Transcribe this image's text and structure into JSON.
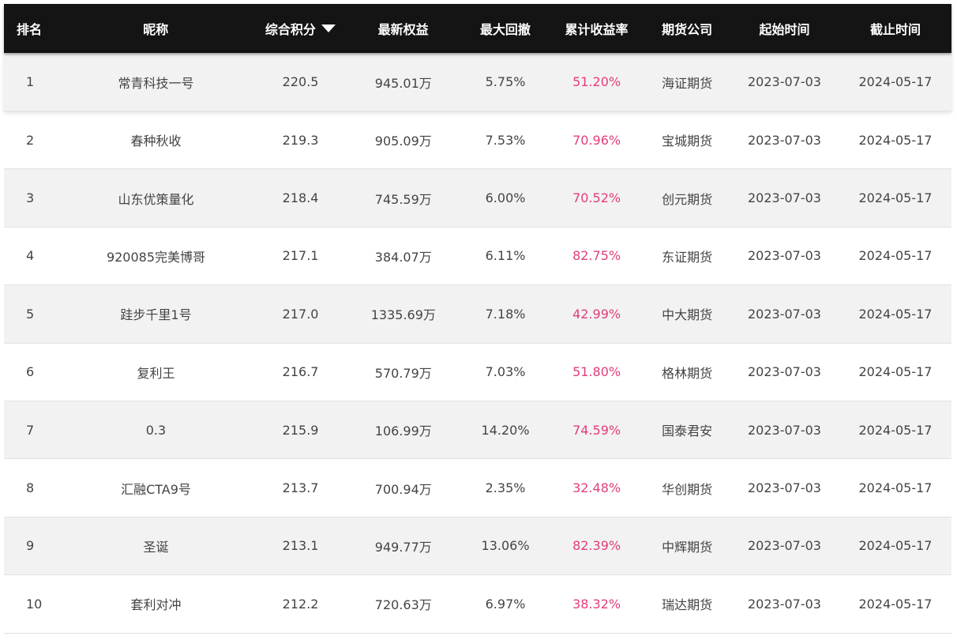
{
  "header": {
    "rank": "排名",
    "name": "昵称",
    "score": "综合积分",
    "equity": "最新权益",
    "drawdown": "最大回撤",
    "return": "累计收益率",
    "company": "期货公司",
    "start": "起始时间",
    "end": "截止时间"
  },
  "sort_icon": "triangle-down-icon",
  "colors": {
    "header_bg": "#141414",
    "return_color": "#e23d7c",
    "stripe": "#f2f2f2"
  },
  "rows": [
    {
      "rank": "1",
      "name": "常青科技一号",
      "score": "220.5",
      "equity": "945.01万",
      "drawdown": "5.75%",
      "return": "51.20%",
      "company": "海证期货",
      "start": "2023-07-03",
      "end": "2024-05-17"
    },
    {
      "rank": "2",
      "name": "春种秋收",
      "score": "219.3",
      "equity": "905.09万",
      "drawdown": "7.53%",
      "return": "70.96%",
      "company": "宝城期货",
      "start": "2023-07-03",
      "end": "2024-05-17"
    },
    {
      "rank": "3",
      "name": "山东优策量化",
      "score": "218.4",
      "equity": "745.59万",
      "drawdown": "6.00%",
      "return": "70.52%",
      "company": "创元期货",
      "start": "2023-07-03",
      "end": "2024-05-17"
    },
    {
      "rank": "4",
      "name": "920085完美博哥",
      "score": "217.1",
      "equity": "384.07万",
      "drawdown": "6.11%",
      "return": "82.75%",
      "company": "东证期货",
      "start": "2023-07-03",
      "end": "2024-05-17"
    },
    {
      "rank": "5",
      "name": "跬步千里1号",
      "score": "217.0",
      "equity": "1335.69万",
      "drawdown": "7.18%",
      "return": "42.99%",
      "company": "中大期货",
      "start": "2023-07-03",
      "end": "2024-05-17"
    },
    {
      "rank": "6",
      "name": "复利王",
      "score": "216.7",
      "equity": "570.79万",
      "drawdown": "7.03%",
      "return": "51.80%",
      "company": "格林期货",
      "start": "2023-07-03",
      "end": "2024-05-17"
    },
    {
      "rank": "7",
      "name": "0.3",
      "score": "215.9",
      "equity": "106.99万",
      "drawdown": "14.20%",
      "return": "74.59%",
      "company": "国泰君安",
      "start": "2023-07-03",
      "end": "2024-05-17"
    },
    {
      "rank": "8",
      "name": "汇融CTA9号",
      "score": "213.7",
      "equity": "700.94万",
      "drawdown": "2.35%",
      "return": "32.48%",
      "company": "华创期货",
      "start": "2023-07-03",
      "end": "2024-05-17"
    },
    {
      "rank": "9",
      "name": "圣诞",
      "score": "213.1",
      "equity": "949.77万",
      "drawdown": "13.06%",
      "return": "82.39%",
      "company": "中辉期货",
      "start": "2023-07-03",
      "end": "2024-05-17"
    },
    {
      "rank": "10",
      "name": "套利对冲",
      "score": "212.2",
      "equity": "720.63万",
      "drawdown": "6.97%",
      "return": "38.32%",
      "company": "瑞达期货",
      "start": "2023-07-03",
      "end": "2024-05-17"
    }
  ]
}
